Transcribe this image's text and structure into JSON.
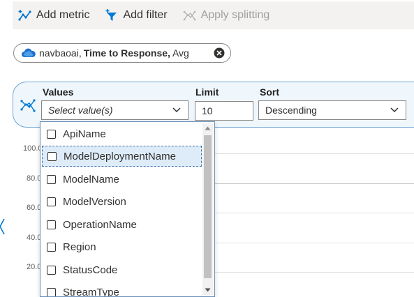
{
  "toolbar": {
    "add_metric": "Add metric",
    "add_filter": "Add filter",
    "apply_splitting": "Apply splitting",
    "icons": {
      "add_metric": "add-metric-icon",
      "add_filter": "funnel-plus-icon",
      "apply_splitting": "splitting-icon"
    }
  },
  "metric_pill": {
    "resource": "navbaoai,",
    "metric": "Time to Response,",
    "aggregation": "Avg",
    "icons": {
      "resource": "cloud-icon",
      "remove": "close-circle-icon"
    }
  },
  "splitting": {
    "values_label": "Values",
    "values_placeholder": "Select value(s)",
    "limit_label": "Limit",
    "limit_value": "10",
    "sort_label": "Sort",
    "sort_value": "Descending"
  },
  "chart": {
    "y_ticks": [
      "100.0",
      "80.0",
      "60.0",
      "40.0",
      "20.0"
    ]
  },
  "dropdown": {
    "options": [
      {
        "label": "ApiName",
        "checked": false
      },
      {
        "label": "ModelDeploymentName",
        "checked": false,
        "focused": true
      },
      {
        "label": "ModelName",
        "checked": false
      },
      {
        "label": "ModelVersion",
        "checked": false
      },
      {
        "label": "OperationName",
        "checked": false
      },
      {
        "label": "Region",
        "checked": false
      },
      {
        "label": "StatusCode",
        "checked": false
      },
      {
        "label": "StreamType",
        "checked": false
      }
    ]
  },
  "colors": {
    "accent": "#0078d4",
    "panel_bg": "#eff6fc",
    "panel_border": "#6ca4d6",
    "highlight": "#deecf9"
  }
}
